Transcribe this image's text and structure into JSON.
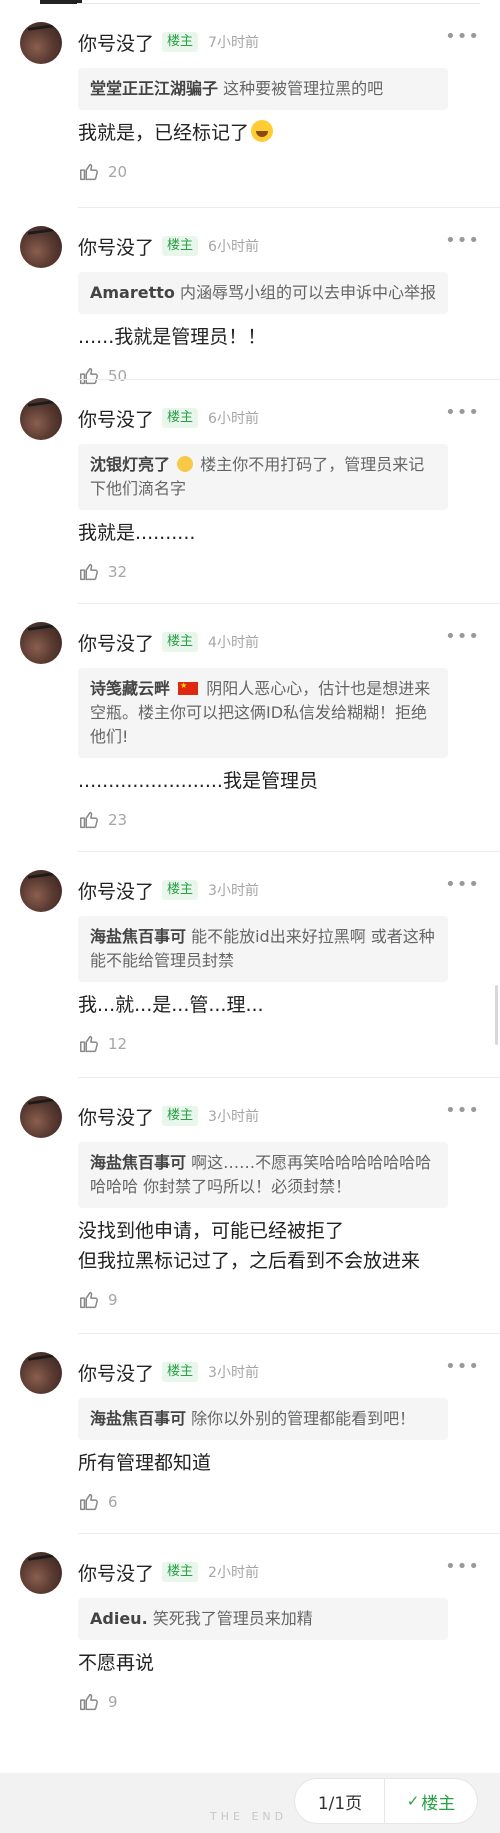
{
  "thread": {
    "comments": [
      {
        "user": "你号没了",
        "badge": "楼主",
        "time": "7小时前",
        "quote_user": "堂堂正正江湖骗子",
        "quote_text": "这种要被管理拉黑的吧",
        "body": "我就是，已经标记了",
        "likes": "20"
      },
      {
        "user": "你号没了",
        "badge": "楼主",
        "time": "6小时前",
        "quote_user": "Amaretto",
        "quote_text": "内涵辱骂小组的可以去申诉中心举报",
        "body": "......我就是管理员！！",
        "likes": "50"
      },
      {
        "user": "你号没了",
        "badge": "楼主",
        "time": "6小时前",
        "quote_user": "沈银灯亮了",
        "quote_text": "楼主你不用打码了，管理员来记下他们滴名字",
        "body": "我就是..........",
        "likes": "32"
      },
      {
        "user": "你号没了",
        "badge": "楼主",
        "time": "4小时前",
        "quote_user": "诗笺藏云畔",
        "quote_text": "阴阳人恶心心，估计也是想进来空瓶。楼主你可以把这俩ID私信发给糊糊！拒绝他们!",
        "body": "........................我是管理员",
        "likes": "23"
      },
      {
        "user": "你号没了",
        "badge": "楼主",
        "time": "3小时前",
        "quote_user": "海盐焦百事可",
        "quote_text": "能不能放id出来好拉黑啊  或者这种能不能给管理员封禁",
        "body": "我...就...是...管...理...",
        "likes": "12"
      },
      {
        "user": "你号没了",
        "badge": "楼主",
        "time": "3小时前",
        "quote_user": "海盐焦百事可",
        "quote_text": "啊这……不愿再笑哈哈哈哈哈哈哈哈哈哈     你封禁了吗所以！必须封禁！",
        "body": "没找到他申请，可能已经被拒了\n但我拉黑标记过了，之后看到不会放进来",
        "likes": "9"
      },
      {
        "user": "你号没了",
        "badge": "楼主",
        "time": "3小时前",
        "quote_user": "海盐焦百事可",
        "quote_text": "除你以外别的管理都能看到吧！",
        "body": "所有管理都知道",
        "likes": "6"
      },
      {
        "user": "你号没了",
        "badge": "楼主",
        "time": "2小时前",
        "quote_user": "Adieu.",
        "quote_text": "笑死我了管理员来加精",
        "body": "不愿再说",
        "likes": "9"
      }
    ]
  },
  "footer": {
    "the_end": "THE END",
    "pager": "1/1页",
    "filter_label": "楼主"
  },
  "colors": {
    "accent_green": "#2aa146",
    "muted": "#a6a6a6",
    "quote_bg": "#f5f5f5"
  }
}
